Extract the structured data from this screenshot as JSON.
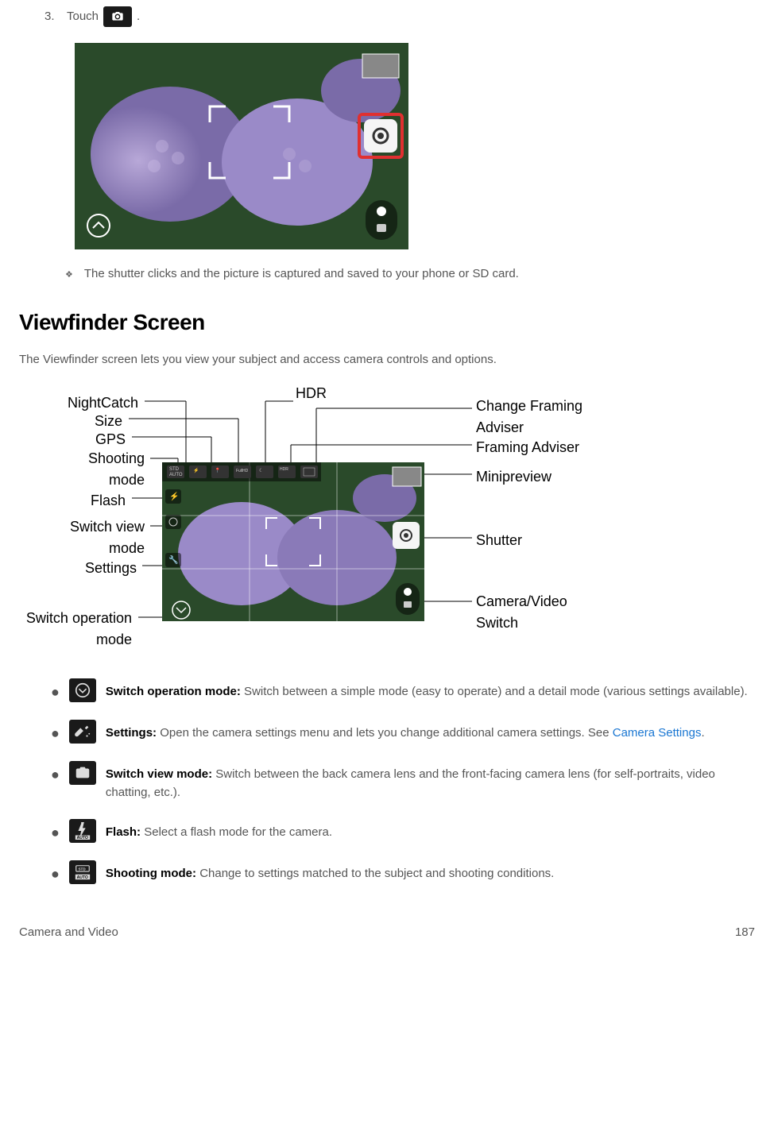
{
  "step": {
    "number": "3.",
    "prefix": "Touch",
    "suffix": "."
  },
  "note": {
    "bullet": "❖",
    "text": "The shutter clicks and the picture is captured and saved to your phone or SD card."
  },
  "section": {
    "title": "Viewfinder Screen",
    "desc": "The Viewfinder screen lets you view your subject and access camera controls and options."
  },
  "labels": {
    "nightcatch": "NightCatch",
    "size": "Size",
    "gps": "GPS",
    "shooting_mode": "Shooting",
    "shooting_mode2": "mode",
    "flash": "Flash",
    "switch_view": "Switch view",
    "switch_view2": "mode",
    "settings": "Settings",
    "switch_op": "Switch operation",
    "switch_op2": "mode",
    "hdr": "HDR",
    "change_framing": "Change Framing",
    "change_framing2": "Adviser",
    "framing_adviser": "Framing Adviser",
    "minipreview": "Minipreview",
    "shutter": "Shutter",
    "camera_video": "Camera/Video",
    "camera_video2": "Switch"
  },
  "items": [
    {
      "icon": "chevron-down-circle",
      "title": "Switch operation mode:",
      "body": " Switch between a simple mode (easy to operate) and a detail mode (various settings available)."
    },
    {
      "icon": "wrench-star",
      "title": "Settings:",
      "body": " Open the camera settings menu and lets you change additional camera settings. See ",
      "link": "Camera Settings",
      "suffix": "."
    },
    {
      "icon": "camera-switch",
      "title": "Switch view mode:",
      "body": " Switch between the back camera lens and the front-facing camera lens (for self-portraits, video chatting, etc.)."
    },
    {
      "icon": "flash-auto",
      "title": "Flash:",
      "body": " Select a flash mode for the camera."
    },
    {
      "icon": "std-auto",
      "title": "Shooting mode:",
      "body": " Change to settings matched to the subject and shooting conditions."
    }
  ],
  "footer": {
    "left": "Camera and Video",
    "right": "187"
  }
}
